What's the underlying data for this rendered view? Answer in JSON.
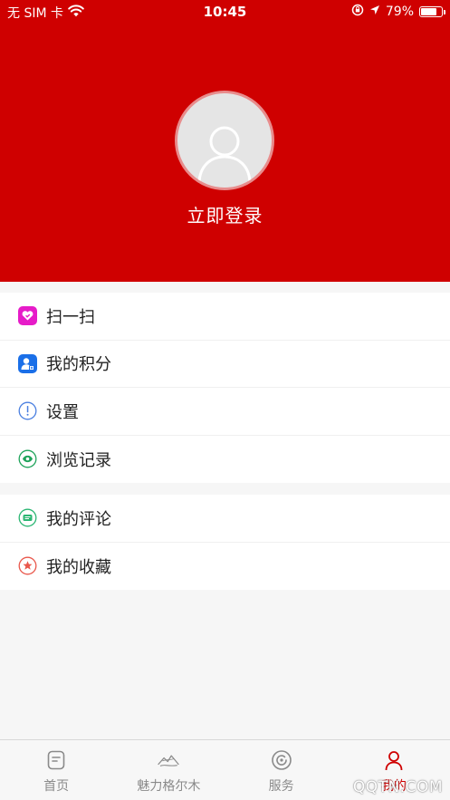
{
  "status_bar": {
    "carrier": "无 SIM 卡",
    "time": "10:45",
    "battery": "79%",
    "battery_level": 0.79
  },
  "profile": {
    "login_label": "立即登录"
  },
  "menu": {
    "group1": [
      {
        "label": "扫一扫",
        "icon": "scan-icon",
        "color": "#e61cc8"
      },
      {
        "label": "我的积分",
        "icon": "points-icon",
        "color": "#1a6fe8"
      },
      {
        "label": "设置",
        "icon": "settings-icon",
        "color": "#4a7fe0"
      },
      {
        "label": "浏览记录",
        "icon": "history-icon",
        "color": "#1ea35a"
      }
    ],
    "group2": [
      {
        "label": "我的评论",
        "icon": "comment-icon",
        "color": "#2bb673"
      },
      {
        "label": "我的收藏",
        "icon": "favorite-icon",
        "color": "#e9574b"
      }
    ]
  },
  "tabbar": {
    "tabs": [
      {
        "label": "首页",
        "icon": "home-icon"
      },
      {
        "label": "魅力格尔木",
        "icon": "scenery-icon"
      },
      {
        "label": "服务",
        "icon": "service-icon"
      },
      {
        "label": "我的",
        "icon": "user-icon",
        "active": true
      }
    ]
  },
  "watermark": "QQTN.COM",
  "colors": {
    "brand_red": "#cf0000",
    "tab_inactive": "#8a8a8a"
  }
}
